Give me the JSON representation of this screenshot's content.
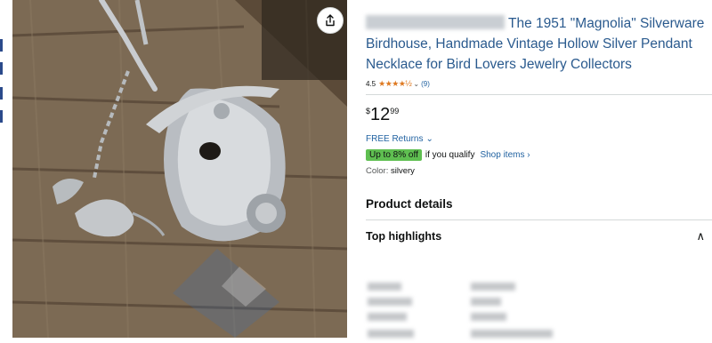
{
  "product": {
    "title_visible": "The 1951 \"Magnolia\" Silverware Birdhouse, Handmade Vintage Hollow Silver Pendant Necklace for Bird Lovers Jewelry Collectors",
    "rating": "4.5",
    "stars_glyphs": "★★★★½",
    "rating_chevron": "⌄",
    "review_count": "(9)",
    "price": {
      "symbol": "$",
      "whole": "12",
      "fraction": "99"
    },
    "returns_label": "FREE Returns",
    "returns_chevron": "⌄",
    "promo_badge": "Up to 8% off",
    "promo_text": "if you qualify",
    "shop_link": "Shop items ›",
    "color_label": "Color:",
    "color_value": "silvery"
  },
  "sections": {
    "product_details": "Product details",
    "top_highlights": "Top highlights",
    "collapse_chevron": "∧"
  },
  "icons": {
    "share": "share-icon"
  },
  "colors": {
    "link": "#2162a1",
    "title": "#2a5a8e",
    "star": "#de7921",
    "promo_green": "#5fbf51"
  }
}
